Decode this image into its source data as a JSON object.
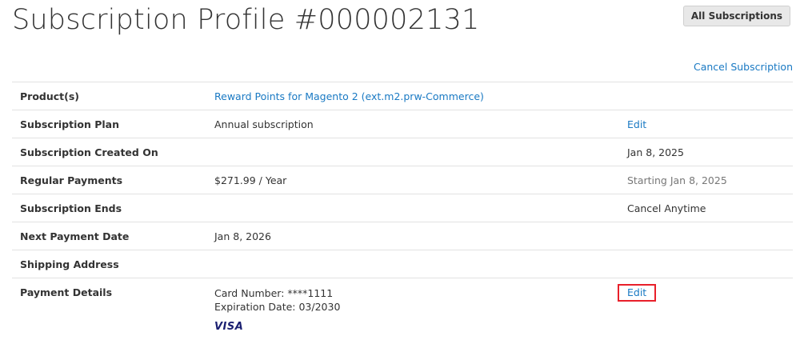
{
  "header": {
    "title": "Subscription Profile #000002131",
    "all_subscriptions_label": "All Subscriptions",
    "cancel_subscription_label": "Cancel Subscription"
  },
  "rows": [
    {
      "label": "Product(s)",
      "value": "Reward Points for Magento 2 (ext.m2.prw-Commerce)",
      "extra": ""
    },
    {
      "label": "Subscription Plan",
      "value": "Annual subscription",
      "extra": "Edit"
    },
    {
      "label": "Subscription Created On",
      "value": "",
      "extra": "Jan 8, 2025"
    },
    {
      "label": "Regular Payments",
      "value": "$271.99 / Year",
      "extra": "Starting Jan 8, 2025"
    },
    {
      "label": "Subscription Ends",
      "value": "",
      "extra": "Cancel Anytime"
    },
    {
      "label": "Next Payment Date",
      "value": "Jan 8, 2026",
      "extra": ""
    },
    {
      "label": "Shipping Address",
      "value": "",
      "extra": ""
    }
  ],
  "payment": {
    "label": "Payment Details",
    "card_number": "Card Number: ****1111",
    "expiration": "Expiration Date: 03/2030",
    "card_brand": "VISA",
    "edit_label": "Edit"
  },
  "colors": {
    "link": "#1979c3",
    "highlight": "#e8202a",
    "visa": "#1a1f71"
  }
}
